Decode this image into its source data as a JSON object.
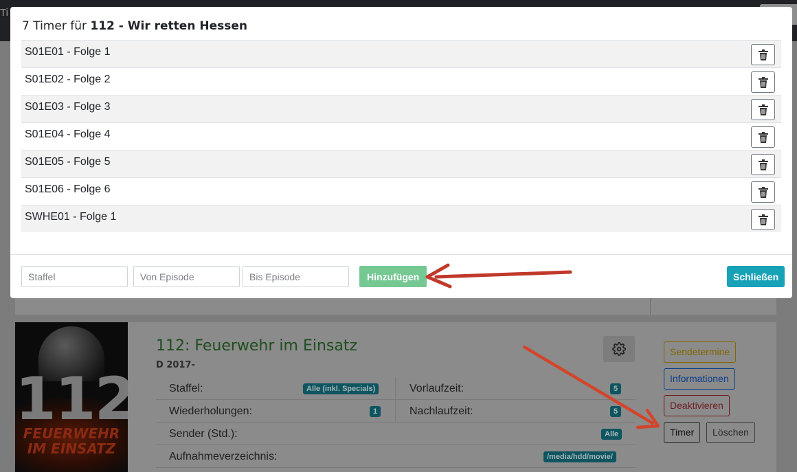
{
  "background": {
    "topbar_title": "Ti",
    "card": {
      "title": "112: Feuerwehr im Einsatz",
      "subtitle": "D 2017-",
      "poster": {
        "number": "112",
        "line1": "FEUERWEHR",
        "line2": "IM EINSATZ"
      },
      "info": {
        "staffel_label": "Staffel:",
        "staffel_value": "Alle (inkl. Specials)",
        "vorlaufzeit_label": "Vorlaufzeit:",
        "vorlaufzeit_value": "5",
        "wiederholungen_label": "Wiederholungen:",
        "wiederholungen_value": "1",
        "nachlaufzeit_label": "Nachlaufzeit:",
        "nachlaufzeit_value": "5",
        "sender_label": "Sender (Std.):",
        "sender_value": "Alle",
        "verzeichnis_label": "Aufnahmeverzeichnis:",
        "verzeichnis_value": "/media/hdd/movie/"
      },
      "buttons": {
        "sendetermine": "Sendetermine",
        "informationen": "Informationen",
        "deaktivieren": "Deaktivieren",
        "timer": "Timer",
        "loeschen": "Löschen"
      }
    }
  },
  "modal": {
    "title_prefix": "7 Timer für",
    "title_show": "112 - Wir retten Hessen",
    "timers": [
      {
        "label": "S01E01 - Folge 1"
      },
      {
        "label": "S01E02 - Folge 2"
      },
      {
        "label": "S01E03 - Folge 3"
      },
      {
        "label": "S01E04 - Folge 4"
      },
      {
        "label": "S01E05 - Folge 5"
      },
      {
        "label": "S01E06 - Folge 6"
      },
      {
        "label": "SWHE01 - Folge 1"
      }
    ],
    "footer": {
      "staffel_placeholder": "Staffel",
      "von_placeholder": "Von Episode",
      "bis_placeholder": "Bis Episode",
      "add_label": "Hinzufügen",
      "close_label": "Schließen"
    }
  },
  "colors": {
    "accent_teal": "#17a2b8",
    "add_green": "#76c893",
    "arrow_red": "#c0392b"
  }
}
